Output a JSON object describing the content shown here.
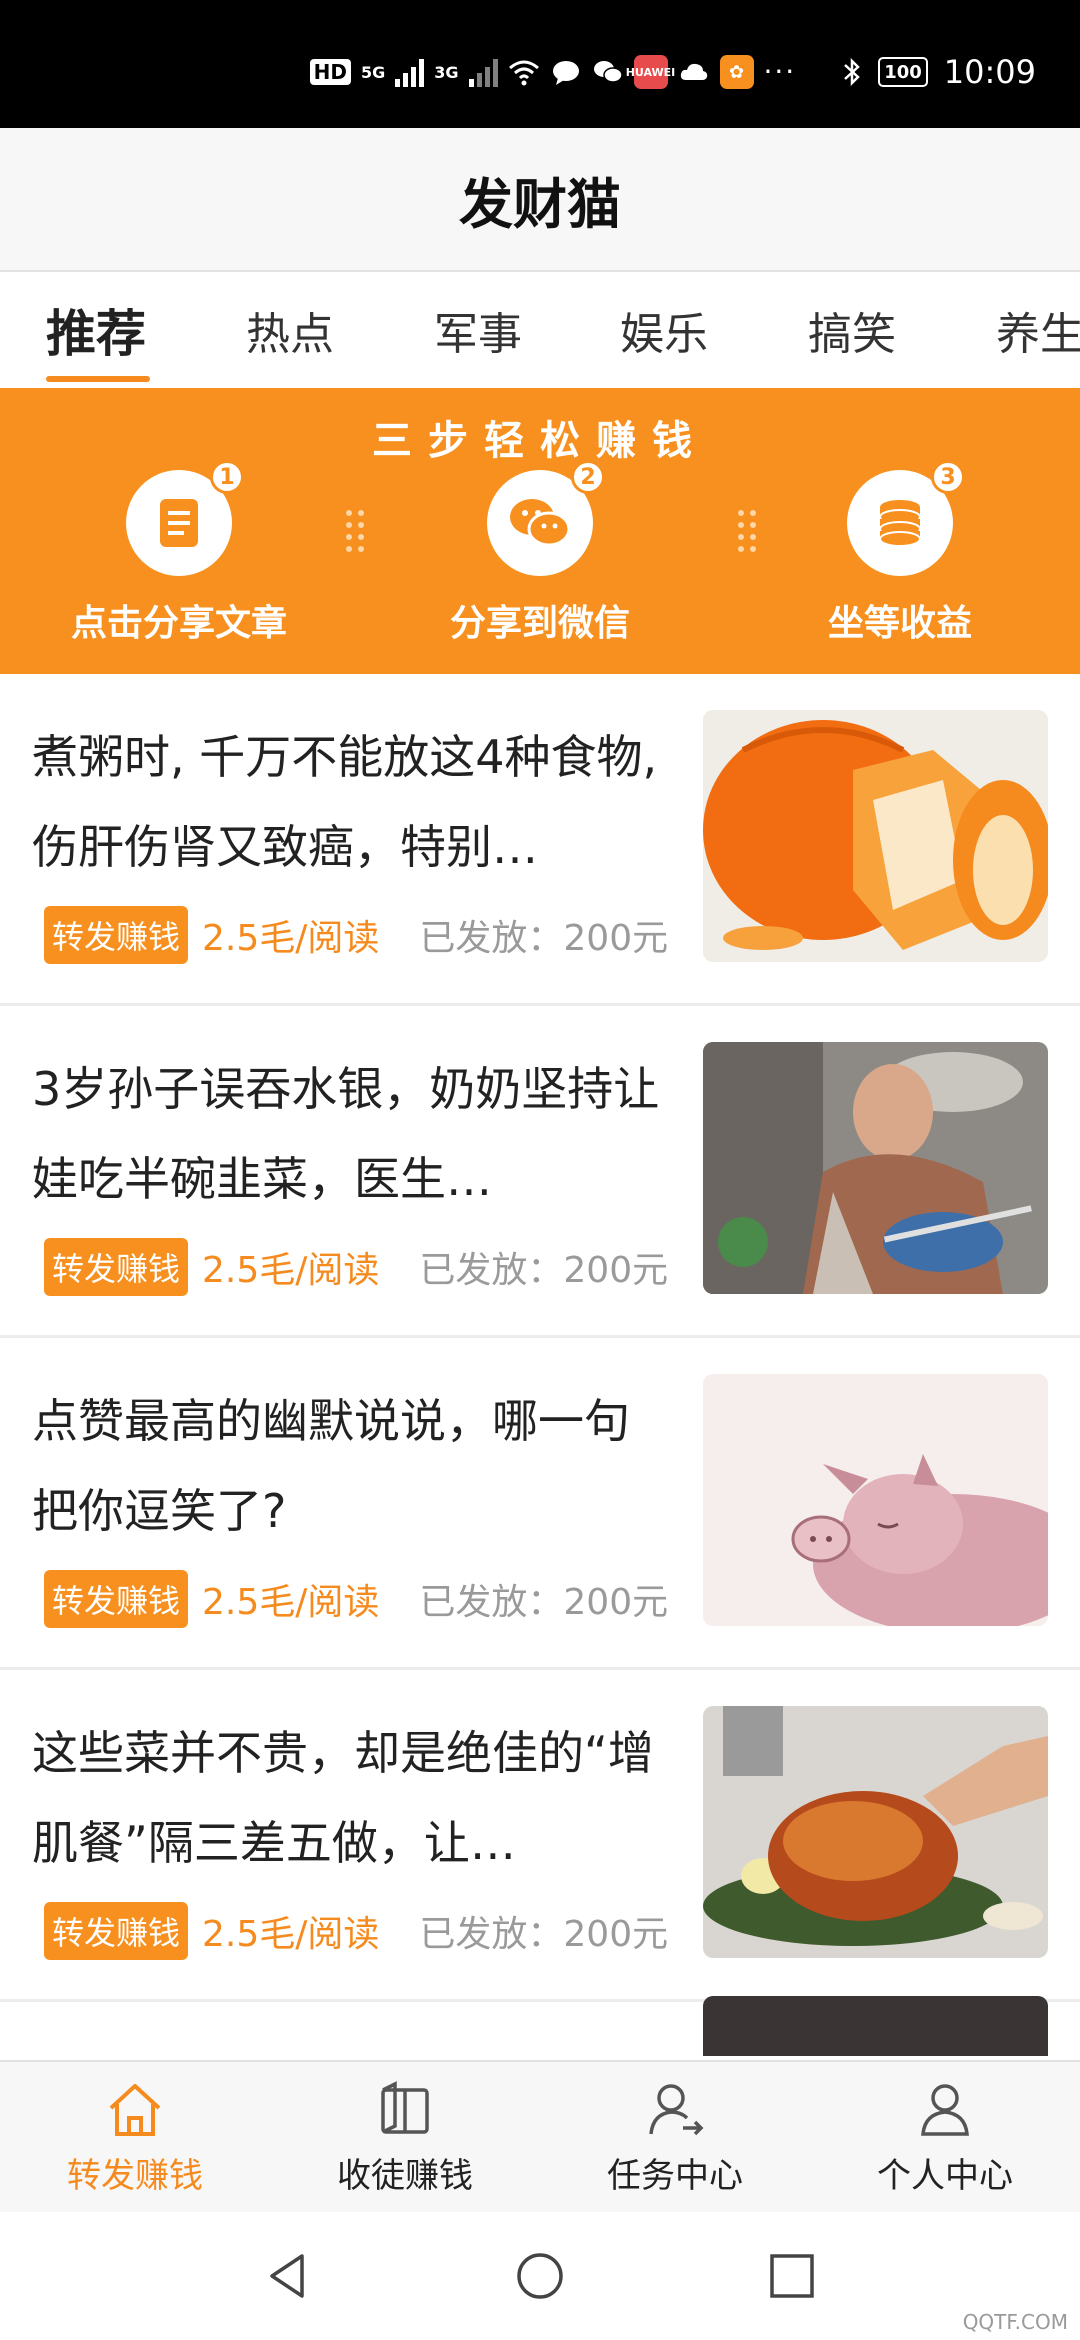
{
  "status_bar": {
    "hd_label": "HD",
    "net_5g": "5G",
    "net_3g": "3G",
    "app_badge": "HUAWEI",
    "battery": "100",
    "time": "10:09"
  },
  "app_title": "发财猫",
  "tabs": [
    {
      "label": "推荐",
      "active": true
    },
    {
      "label": "热点",
      "active": false
    },
    {
      "label": "军事",
      "active": false
    },
    {
      "label": "娱乐",
      "active": false
    },
    {
      "label": "搞笑",
      "active": false
    },
    {
      "label": "养生",
      "active": false
    }
  ],
  "banner": {
    "title": "三步轻松赚钱",
    "steps": [
      {
        "num": "1",
        "label": "点击分享文章",
        "icon": "document-icon"
      },
      {
        "num": "2",
        "label": "分享到微信",
        "icon": "wechat-icon"
      },
      {
        "num": "3",
        "label": "坐等收益",
        "icon": "coins-icon"
      }
    ]
  },
  "articles": [
    {
      "title": "煮粥时, 千万不能放这4种食物, 伤肝伤肾又致癌，特别…",
      "tag": "转发赚钱",
      "rate": "2.5毛/阅读",
      "issued": "已发放：200元",
      "thumb": "pumpkin-image"
    },
    {
      "title": "3岁孙子误吞水银，奶奶坚持让娃吃半碗韭菜，医生…",
      "tag": "转发赚钱",
      "rate": "2.5毛/阅读",
      "issued": "已发放：200元",
      "thumb": "grandma-child-image"
    },
    {
      "title": "点赞最高的幽默说说，哪一句把你逗笑了?",
      "tag": "转发赚钱",
      "rate": "2.5毛/阅读",
      "issued": "已发放：200元",
      "thumb": "cartoon-pig-image"
    },
    {
      "title": "这些菜并不贵，却是绝佳的“增肌餐”隔三差五做，让…",
      "tag": "转发赚钱",
      "rate": "2.5毛/阅读",
      "issued": "已发放：200元",
      "thumb": "roast-chicken-image"
    }
  ],
  "bottom_nav": [
    {
      "label": "转发赚钱",
      "icon": "home-icon",
      "active": true
    },
    {
      "label": "收徒赚钱",
      "icon": "book-icon",
      "active": false
    },
    {
      "label": "任务中心",
      "icon": "user-task-icon",
      "active": false
    },
    {
      "label": "个人中心",
      "icon": "person-icon",
      "active": false
    }
  ],
  "watermark": "QQTF.COM",
  "colors": {
    "accent": "#f7901e",
    "text_gray": "#9a9a9a",
    "status_bar": "#000000"
  }
}
